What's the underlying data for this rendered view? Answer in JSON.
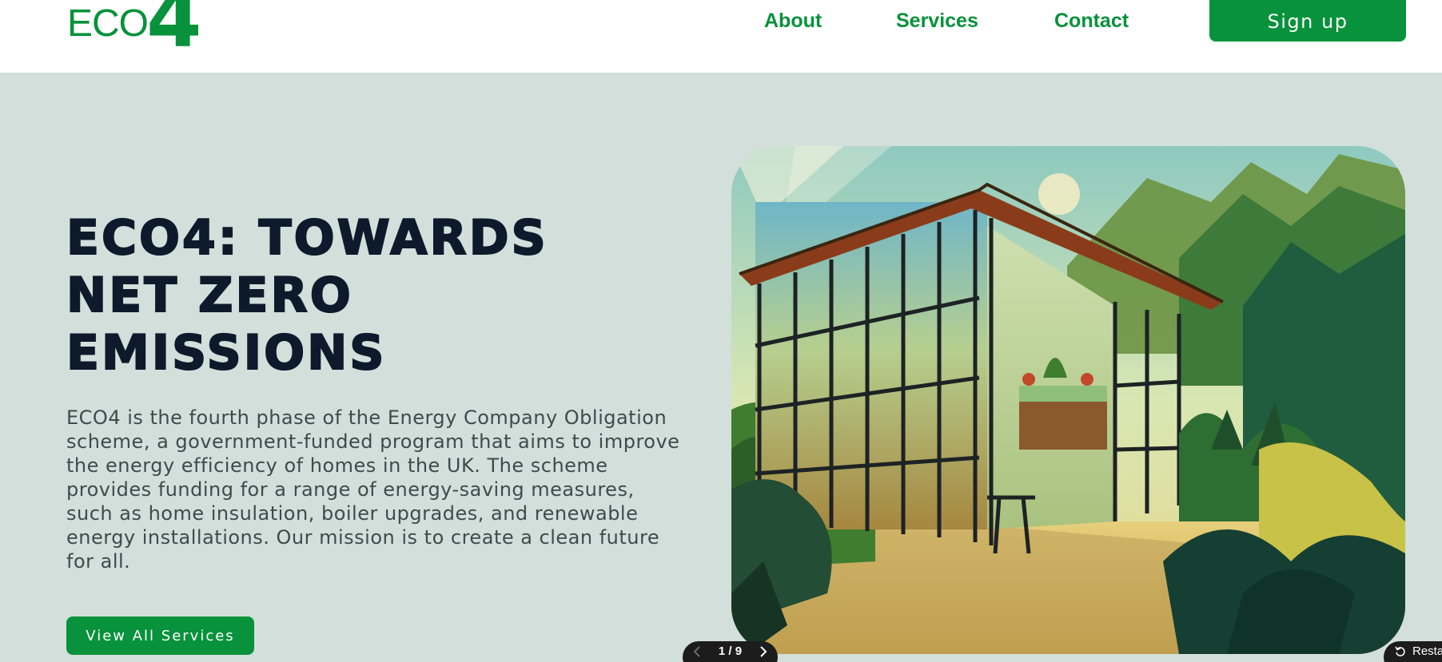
{
  "header": {
    "logo": {
      "prefix": "ECO",
      "suffix": "4"
    },
    "nav": [
      {
        "label": "About"
      },
      {
        "label": "Services"
      },
      {
        "label": "Contact"
      }
    ],
    "signup_label": "Sign up"
  },
  "hero": {
    "title": "ECO4: TOWARDS NET ZERO EMISSIONS",
    "description": "ECO4 is the fourth phase of the Energy Company Obligation scheme, a government-funded program that aims to improve the energy efficiency of homes in the UK. The scheme provides funding for a range of energy-saving measures, such as home insulation, boiler upgrades, and renewable energy installations. Our mission is to create a clean future for all.",
    "cta_label": "View All Services"
  },
  "carousel": {
    "pager": "1 / 9",
    "restore_label": "Resta"
  },
  "colors": {
    "brand_green": "#07923b",
    "hero_background": "#d3dfdb",
    "title_navy": "#0c1a2b"
  },
  "icons": {
    "prev": "chevron-left-icon",
    "next": "chevron-right-icon",
    "restore": "rotate-ccw-icon"
  }
}
